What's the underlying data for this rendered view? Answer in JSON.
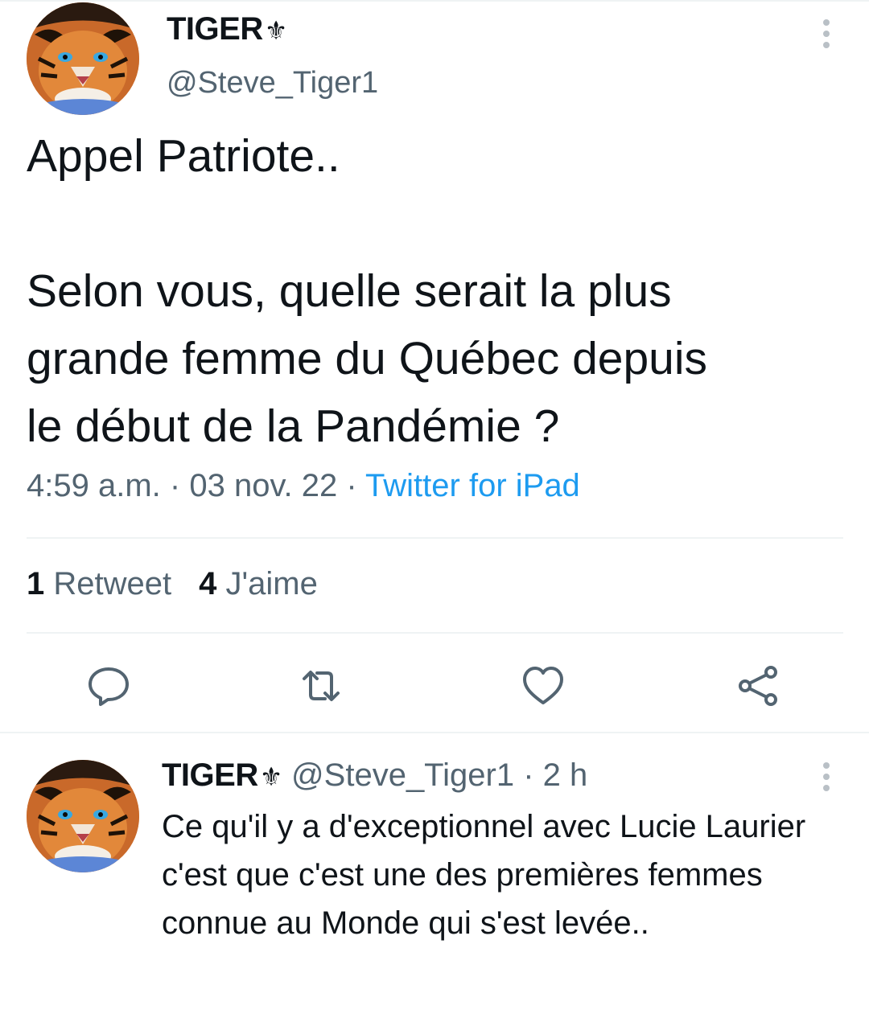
{
  "main_tweet": {
    "display_name": "TIGER",
    "name_emoji": "⚜",
    "handle": "@Steve_Tiger1",
    "text": "Appel Patriote..\n\nSelon vous, quelle serait la plus\ngrande femme du Québec depuis\nle début de la Pandémie ?",
    "time": "4:59 a.m.",
    "separator": "·",
    "date": "03 nov. 22",
    "source": "Twitter for iPad",
    "retweet_count": "1",
    "retweet_label": "Retweet",
    "like_count": "4",
    "like_label": "J'aime"
  },
  "actions": [
    "reply-icon",
    "retweet-icon",
    "like-icon",
    "share-icon"
  ],
  "reply_tweet": {
    "display_name": "TIGER",
    "name_emoji": "⚜",
    "handle": "@Steve_Tiger1",
    "separator": "·",
    "time_ago": "2 h",
    "text": "Ce qu'il y a d'exceptionnel avec Lucie Laurier c'est que c'est une des premières femmes connue au Monde qui s'est levée.."
  },
  "colors": {
    "text": "#0f1419",
    "secondary": "#536471",
    "link": "#1d9bf0",
    "divider": "#eff3f4"
  }
}
